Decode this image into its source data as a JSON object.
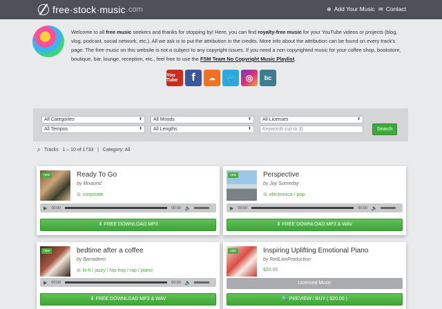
{
  "header": {
    "logo_text": "free·stock·music",
    "logo_suffix": ".com",
    "nav": [
      {
        "icon": "plus-circle-icon",
        "label": "Add Your Music"
      },
      {
        "icon": "envelope-icon",
        "label": "Contact"
      }
    ]
  },
  "intro": {
    "p1": "Welcome to all ",
    "b1": "free music",
    "p2": " seekers and thanks for stopping by! Here, you can find ",
    "b2": "royalty-free music",
    "p3": " for your YouTube videos or projects (blog, vlog, podcast, social network, etc.). All we ask is to put the attribution in the credits. More info about the attribution can be found on every track's page. The free music on this website is not a subject to any copyright issues. If you need a non copyrighted music for your coffee shop, bookstore, boutique, bar, lounge, reception, etc., feel free to use the ",
    "link": "FSM Team No Copyright Music Playlist",
    "p4": "."
  },
  "social": [
    {
      "icon": "youtube-icon",
      "glyph": "You Tube"
    },
    {
      "icon": "facebook-icon",
      "glyph": "f"
    },
    {
      "icon": "soundcloud-icon",
      "glyph": "☁"
    },
    {
      "icon": "twitter-icon",
      "glyph": "🐦"
    },
    {
      "icon": "instagram-icon",
      "glyph": "◎"
    },
    {
      "icon": "bandcamp-icon",
      "glyph": "bc"
    }
  ],
  "filters": {
    "categories": "All Categories",
    "moods": "All Moods",
    "licenses": "All Licenses",
    "tempos": "All Tempos",
    "lengths": "All Lengths",
    "keywords_placeholder": "Keywords (up to 3)",
    "search_label": "Search"
  },
  "tracks_info": {
    "label": "Tracks",
    "range": "1 – 10 of 1733",
    "sep": "|",
    "category": "Category: All"
  },
  "tracks": [
    {
      "badge": "new",
      "title": "Ready To Go",
      "artist": "by Mixaund",
      "genre": "corporate",
      "time": "00:00",
      "button": "FREE DOWNLOAD  MP3"
    },
    {
      "badge": "new",
      "title": "Perspective",
      "artist": "by Jay Someday",
      "genre": "electronica / pop",
      "time": "00:00",
      "button": "FREE DOWNLOAD  MP3 & WAV"
    },
    {
      "badge": "new",
      "title": "bedtime after a coffee",
      "artist": "by Barradeen",
      "genre": "lo-fi / jazzy / hip-hop / rap / piano",
      "time": "00:00",
      "button": "FREE DOWNLOAD  MP3 & WAV"
    },
    {
      "badge": "sale",
      "title": "Inspiring Uplifting Emotional Piano",
      "artist": "by RedLionProduction",
      "price": "$20.00",
      "license_label": "Licensed Music",
      "button": "PREVIEW / BUY ( $20.00 )"
    }
  ]
}
